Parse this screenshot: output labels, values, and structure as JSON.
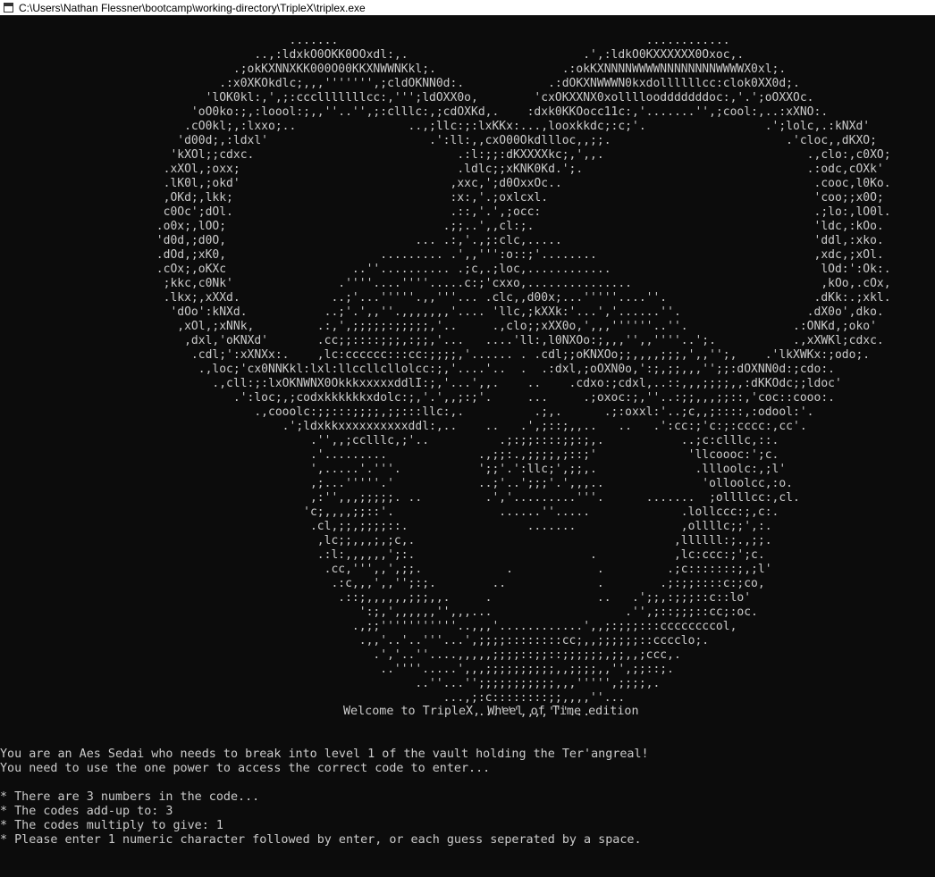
{
  "window": {
    "title": "C:\\Users\\Nathan Flessner\\bootcamp\\working-directory\\TripleX\\triplex.exe"
  },
  "console": {
    "ascii_art": "                          .......                                            ............\n                     ..,:ldxkO0OKK0OOxdl:,.                         .',:ldkO0KXXXXXX0Oxoc,.\n                  .;okKXNNXKK000O00KKXNWWNKkl;.                  .:okKXNNNNWWWWNNNNNNNNWWWWX0xl;.\n                .:x0XKOkdlc;,,,''''''',;cldOKNN0d:.            .:dOKXNWWWN0kxdollllllcc:clok0XX0d;.\n              'lOK0kl:,',;:ccclllllllcc:,''';ldOXX0o,        'cxOKXXNX0xolllloodddddddoc:,'.';oOXXOc.\n            'oO0ko:;,:loool:;,,''..'',;:clllc:,;cdOXKd,.    :dxk0KKOocc11c:,'.......'',;cool:,..:xXNO:.\n           .cO0kl;,:lxxo;..                ..,;llc:;:lxKKx:...,looxkkdc;:c;'.                 .';lolc,.:kNXd'\n          'd00d;,:ldxl'                       .':ll:,,cxO00Okdllloc,,;;.                         .'cloc,,dKXO;\n         'kXOl;;cdxc.                             .:l:;;:dKXXXXkc;,',,.                             .,clo:,c0XO;\n        .xXOl,;oxx;                               .ldlc;;xKNK0Kd.';.                                .:odc,cOXk'\n        .lK0l,;okd'                              ,xxc,';d0OxxOc..                                    .cooc,l0Ko.\n        ,OKd;,lkk;                               :x:,'.;oxlcxl.                                      'coo;;x0O;\n        c0Oc';dOl.                               .::,'.',;occ:                                       .;lo:,lO0l.\n       .o0x;,lOO;                               .;;..',,cl:;.                                        'ldc,:kOo.\n       'd0d,;d0O,                           ... .:,'.,;:clc,.....                                    'ddl,:xko.\n       .dOd,;xK0,                      ......... .',,''':o::;'........                               ,xdc,;xOl.\n       .cOx;,oKXc                  ..''.......... .;c,.;loc,............                              lOd:':Ok:.\n        ;kkc,c0Nk'               .''''....''''.....c:;'cxxo,...............                           ,kOo,.cOx,\n        .lkx;,xXXd.             ..;'...'''''.,,'''... .clc,,d00x;...'''''....''.                     .dKk:.;xkl.\n         'dOo':kNXd.           ..;'.',,''.,,,,,,,'.... 'llc,;kXXk:'...','......''.                  .dX0o',dko.\n          ,xOl,;xNNk,         .:,',;;;;;:;;;;;,'..     .,clo;;xXX0o,',,,''''''..''.               .:ONKd,;oko'\n           ,dxl,'oKNXd'       .cc;;::::;;;,:;;,'...   ....'ll:,l0NXOo:;,,,'',,''''..';.           .,xXWKl;cdxc.\n            .cdl;':xXNXx:.    ,lc:cccccc:::cc:;;;;,'...... . .cdl;;oKNXOo;;,,,,;;;,',,'';,    .'lkXWKx:;odo;.\n             .,loc;'cx0NNKkl:lxl:llccllcllolcc:;,'....'..  .  .:dxl,;oOXN0o,':;,;;,,,'';;:dOXNN0d:;cdo:.\n               .,cll:;:lxOKNWNX0OkkkxxxxxddlI:;,'...',,.    ..    .cdxo:;cdxl,..::,,,;;;;,,:dKKOdc;;ldoc'\n                  .':loc;,;codxkkkkkkxdolc:;,'.',,;:;'.     ...     .;oxoc:;,''..:;;,,,;;::,'coc::cooo:.\n                     .,cooolc:;;:::;;;;,;;:::llc:,.          .;,.      .;:oxxl:'..;c,,;::::,:odool:'.\n                         .';ldxkkxxxxxxxxxxddl:,..    ..   .',;::;,,..   ..   .':cc:;'c:;:cccc:,cc'.\n                             .'',,;cclllc,;'..          .;:;;::::;;:;,.           ..;c:clllc,::.\n                             .'.........             .,;;:.,;;;;,;::;'             'llcoooc:';c.\n                             ',.....'.'''.           ';;'.':llc;',;;,.              .llloolc:,;l'\n                             ,;...'''''.'            ..;'..';;;'.',,,..              'olloolcc,:o.\n                             ,:'',,,;;;;;. ..         .','.........'''.      .......  ;ollllcc:,cl.\n                            'c;,,,,;;::'.               ......''.....             .lollccc:;,c:.\n                             .cl,;;,;;;;::.                 .......               ,ollllc;;',:.\n                              ,lc;;,,,;,;c,.                                     ,llllll:;.,;;.\n                              .:l:,,,,,,';:.                         .           ,lc:ccc:;';c.\n                               .cc,''',,',;;.            .            .         .;c:::::::;,;l'\n                                .:c,,,',,'';:;.        ..             .        .;:;;::::c:;co,\n                                 .::;,,,,,,;;;,,.     .               ..   .';;,:;;;::c::lo'\n                                    ':;,',,,,,,'',,,...                   .'',;::;;;::cc;:oc.\n                                   .,;;'''''''''''..,,,'............',,;:;;;:::ccccccccol,\n                                    .,,'..'..'''...',;;;;::::::::cc;,,;;;;;;::cccclo;.\n                                      .','..''....,,,,,;;;;::;;::;;;;;;,;;,,;ccc,.\n                                       ..''''.....',,,;;;;;;;;;;,,;;;;,,'',;;::;.\n                                            ..''...'';;;;;;;;;;;,,,''''',;;;;,.\n                                                ...,;:c::::::::;;,,,,''...\n                                                     ...''',,,,'''...",
    "welcome": "Welcome to TripleX, Wheel of Time edition",
    "body": "You are an Aes Sedai who needs to break into level 1 of the vault holding the Ter'angreal!\nYou need to use the one power to access the correct code to enter...\n\n* There are 3 numbers in the code...\n* The codes add-up to: 3\n* The codes multiply to give: 1\n* Please enter 1 numeric character followed by enter, or each guess seperated by a space."
  }
}
